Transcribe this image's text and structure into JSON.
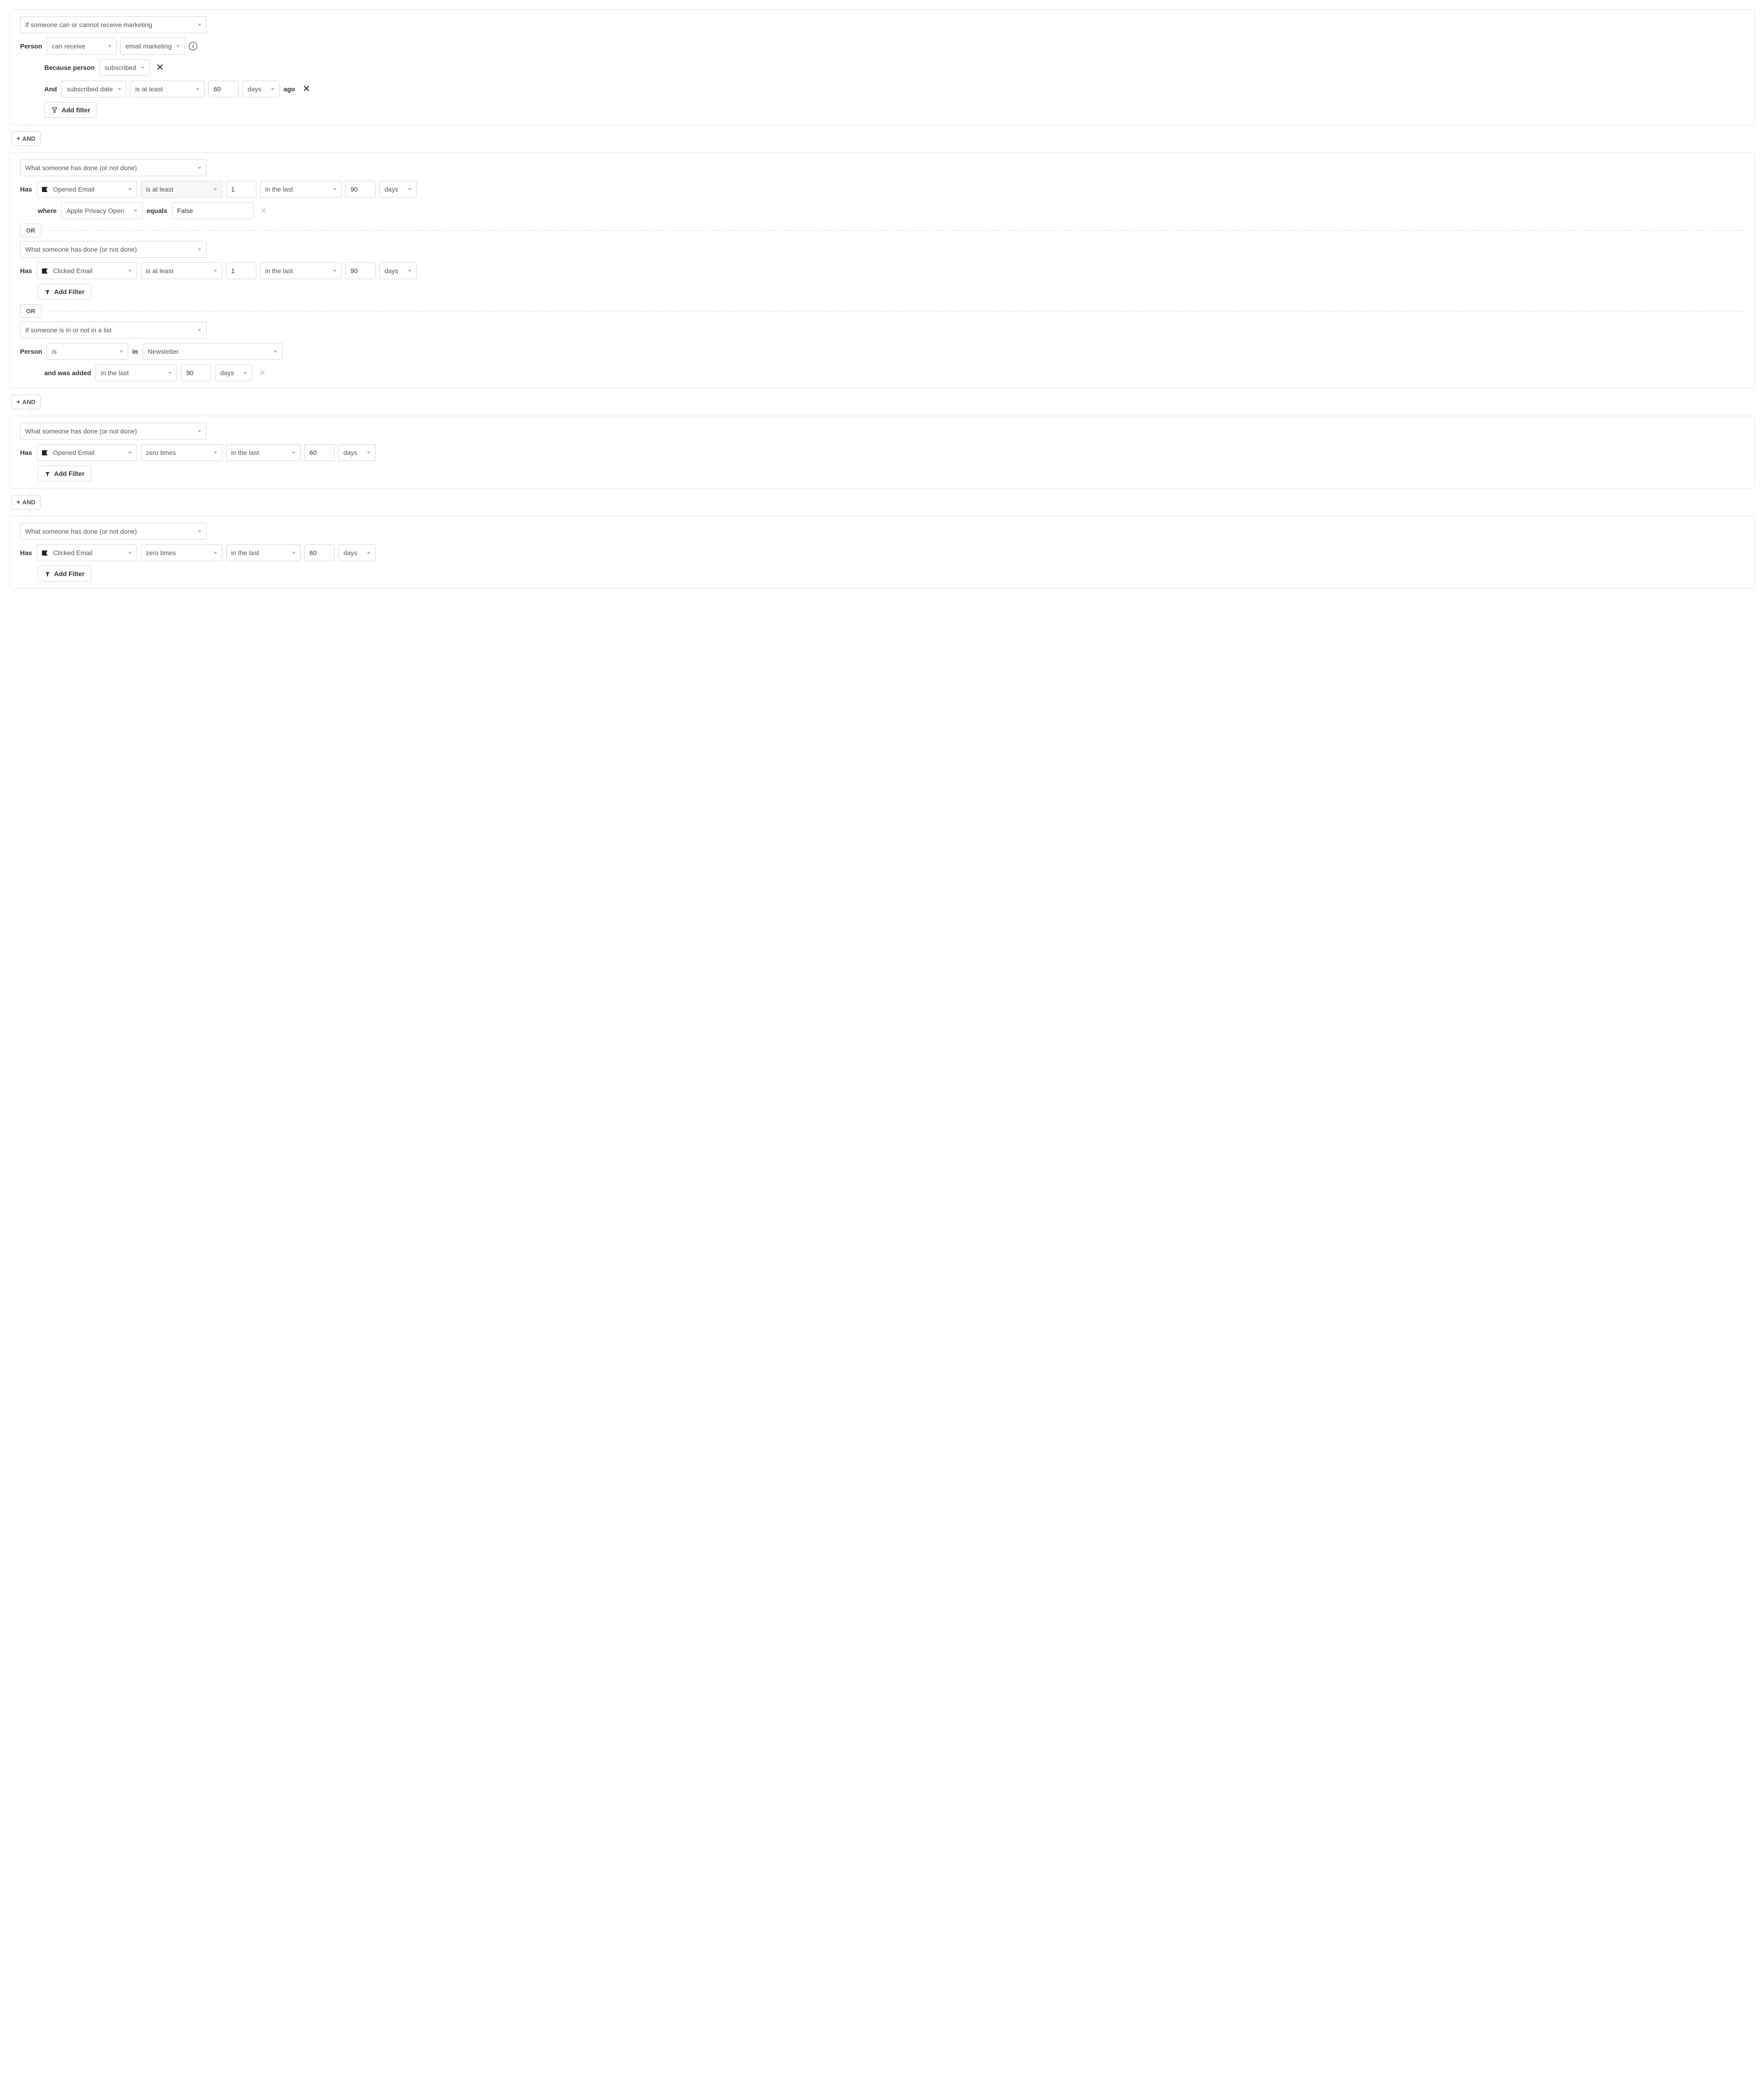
{
  "common": {
    "and": "AND",
    "or": "OR",
    "add_filter_lower": "Add filter",
    "add_filter_upper": "Add Filter"
  },
  "g1": {
    "cond_type": "If someone can or cannot receive marketing",
    "person_label": "Person",
    "can_receive": "can receive",
    "email_marketing": "email marketing",
    "because_label": "Because person",
    "because_val": "subscribed",
    "and_label": "And",
    "sub_date": "subscribed date",
    "op": "is at least",
    "num": "60",
    "unit": "days",
    "ago": "ago"
  },
  "g2a": {
    "cond_type": "What someone has done (or not done)",
    "has_label": "Has",
    "metric": "Opened Email",
    "op": "is at least",
    "count": "1",
    "range": "in the last",
    "num": "90",
    "unit": "days",
    "where_label": "where",
    "where_prop": "Apple Privacy Open",
    "where_eq": "equals",
    "where_val": "False"
  },
  "g2b": {
    "cond_type": "What someone has done (or not done)",
    "has_label": "Has",
    "metric": "Clicked Email",
    "op": "is at least",
    "count": "1",
    "range": "in the last",
    "num": "90",
    "unit": "days"
  },
  "g2c": {
    "cond_type": "If someone is in or not in a list",
    "person_label": "Person",
    "is": "is",
    "in_label": "in",
    "list": "Newsletter",
    "added_label": "and was added",
    "range": "in the last",
    "num": "90",
    "unit": "days"
  },
  "g3": {
    "cond_type": "What someone has done (or not done)",
    "has_label": "Has",
    "metric": "Opened Email",
    "op": "zero times",
    "range": "in the last",
    "num": "60",
    "unit": "days"
  },
  "g4": {
    "cond_type": "What someone has done (or not done)",
    "has_label": "Has",
    "metric": "Clicked Email",
    "op": "zero times",
    "range": "in the last",
    "num": "60",
    "unit": "days"
  }
}
